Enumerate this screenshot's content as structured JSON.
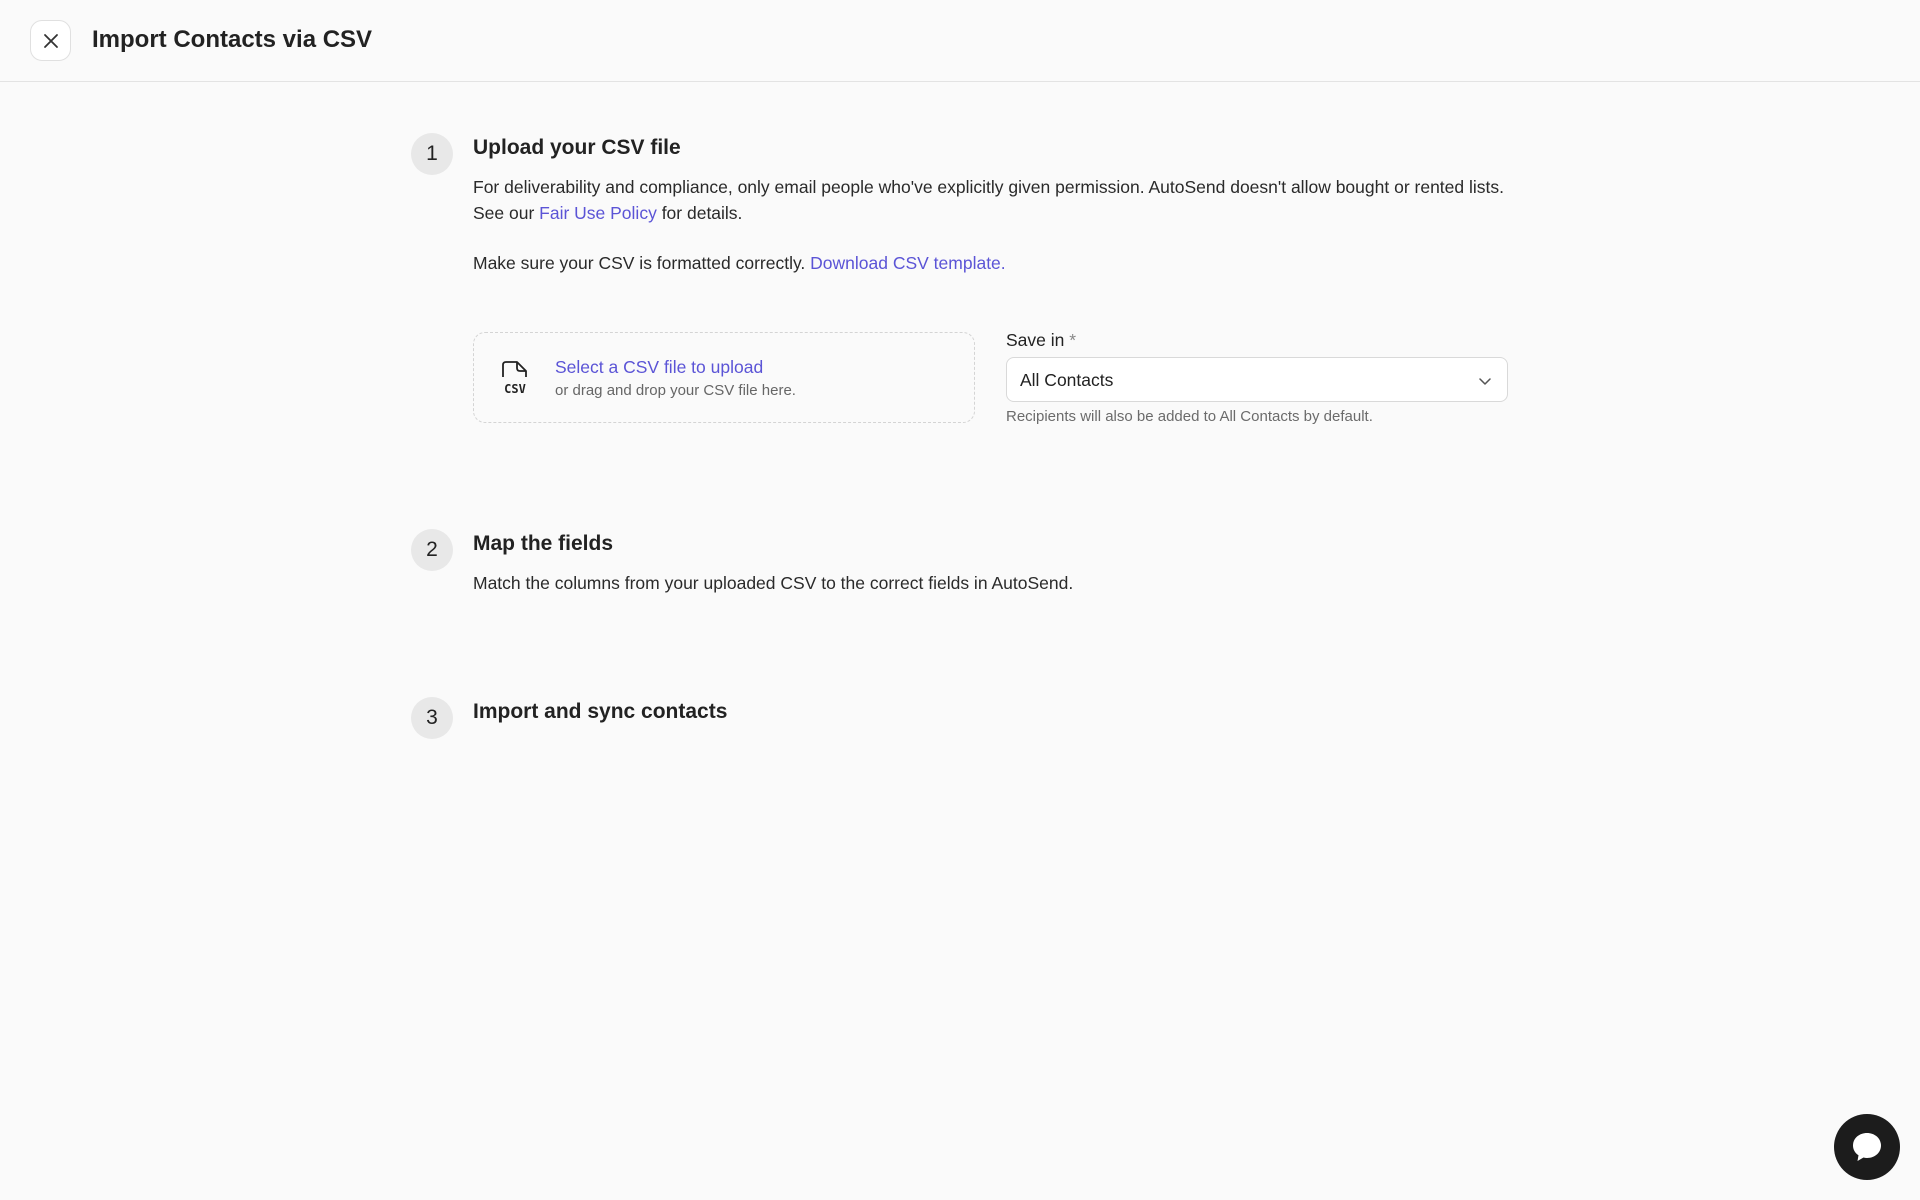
{
  "header": {
    "title": "Import Contacts via CSV",
    "close_icon": "close-icon"
  },
  "steps": [
    {
      "number": "1",
      "title": "Upload your CSV file",
      "para1_before": "For deliverability and compliance, only email people who've explicitly given permission. AutoSend doesn't allow bought or rented lists. See our ",
      "para1_link": "Fair Use Policy",
      "para1_after": " for details.",
      "para2_before": "Make sure your CSV is formatted correctly. ",
      "para2_link": "Download CSV template."
    },
    {
      "number": "2",
      "title": "Map the fields",
      "description": "Match the columns from your uploaded CSV to the correct fields in AutoSend."
    },
    {
      "number": "3",
      "title": "Import and sync contacts"
    }
  ],
  "upload": {
    "icon": "csv-file-icon",
    "icon_text": "CSV",
    "title": "Select a CSV file to upload",
    "subtitle": "or drag and drop your CSV file here."
  },
  "save_in": {
    "label": "Save in",
    "required_mark": "*",
    "selected": "All Contacts",
    "hint": "Recipients will also be added to All Contacts by default."
  },
  "chat": {
    "icon": "chat-bubble-icon"
  },
  "colors": {
    "accent": "#5b54d6",
    "background": "#fafafa",
    "chat_button": "#1c1c1c"
  }
}
